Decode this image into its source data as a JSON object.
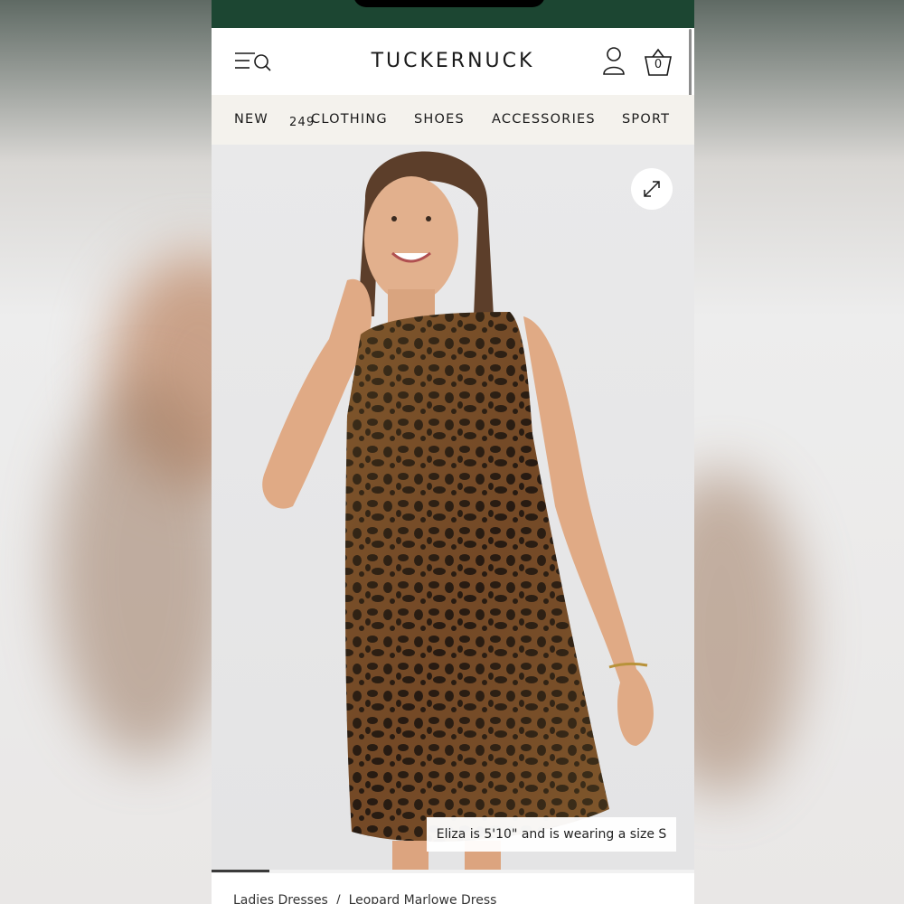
{
  "header": {
    "brand": "TUCKERNUCK",
    "cart_count": "0"
  },
  "nav": {
    "items": [
      {
        "label": "NEW",
        "badge": "249"
      },
      {
        "label": "CLOTHING"
      },
      {
        "label": "SHOES"
      },
      {
        "label": "ACCESSORIES"
      },
      {
        "label": "SPORT"
      }
    ]
  },
  "gallery": {
    "caption": "Eliza is 5'10\" and is wearing a size S",
    "progress": 0.12
  },
  "breadcrumb": {
    "items": [
      "Ladies Dresses",
      "Leopard Marlowe Dress"
    ],
    "separator": "/"
  },
  "colors": {
    "status_bar": "#1c4632",
    "nav_background": "#f4f2ed"
  },
  "icons": [
    "menu-search-icon",
    "account-icon",
    "basket-icon",
    "expand-icon"
  ]
}
